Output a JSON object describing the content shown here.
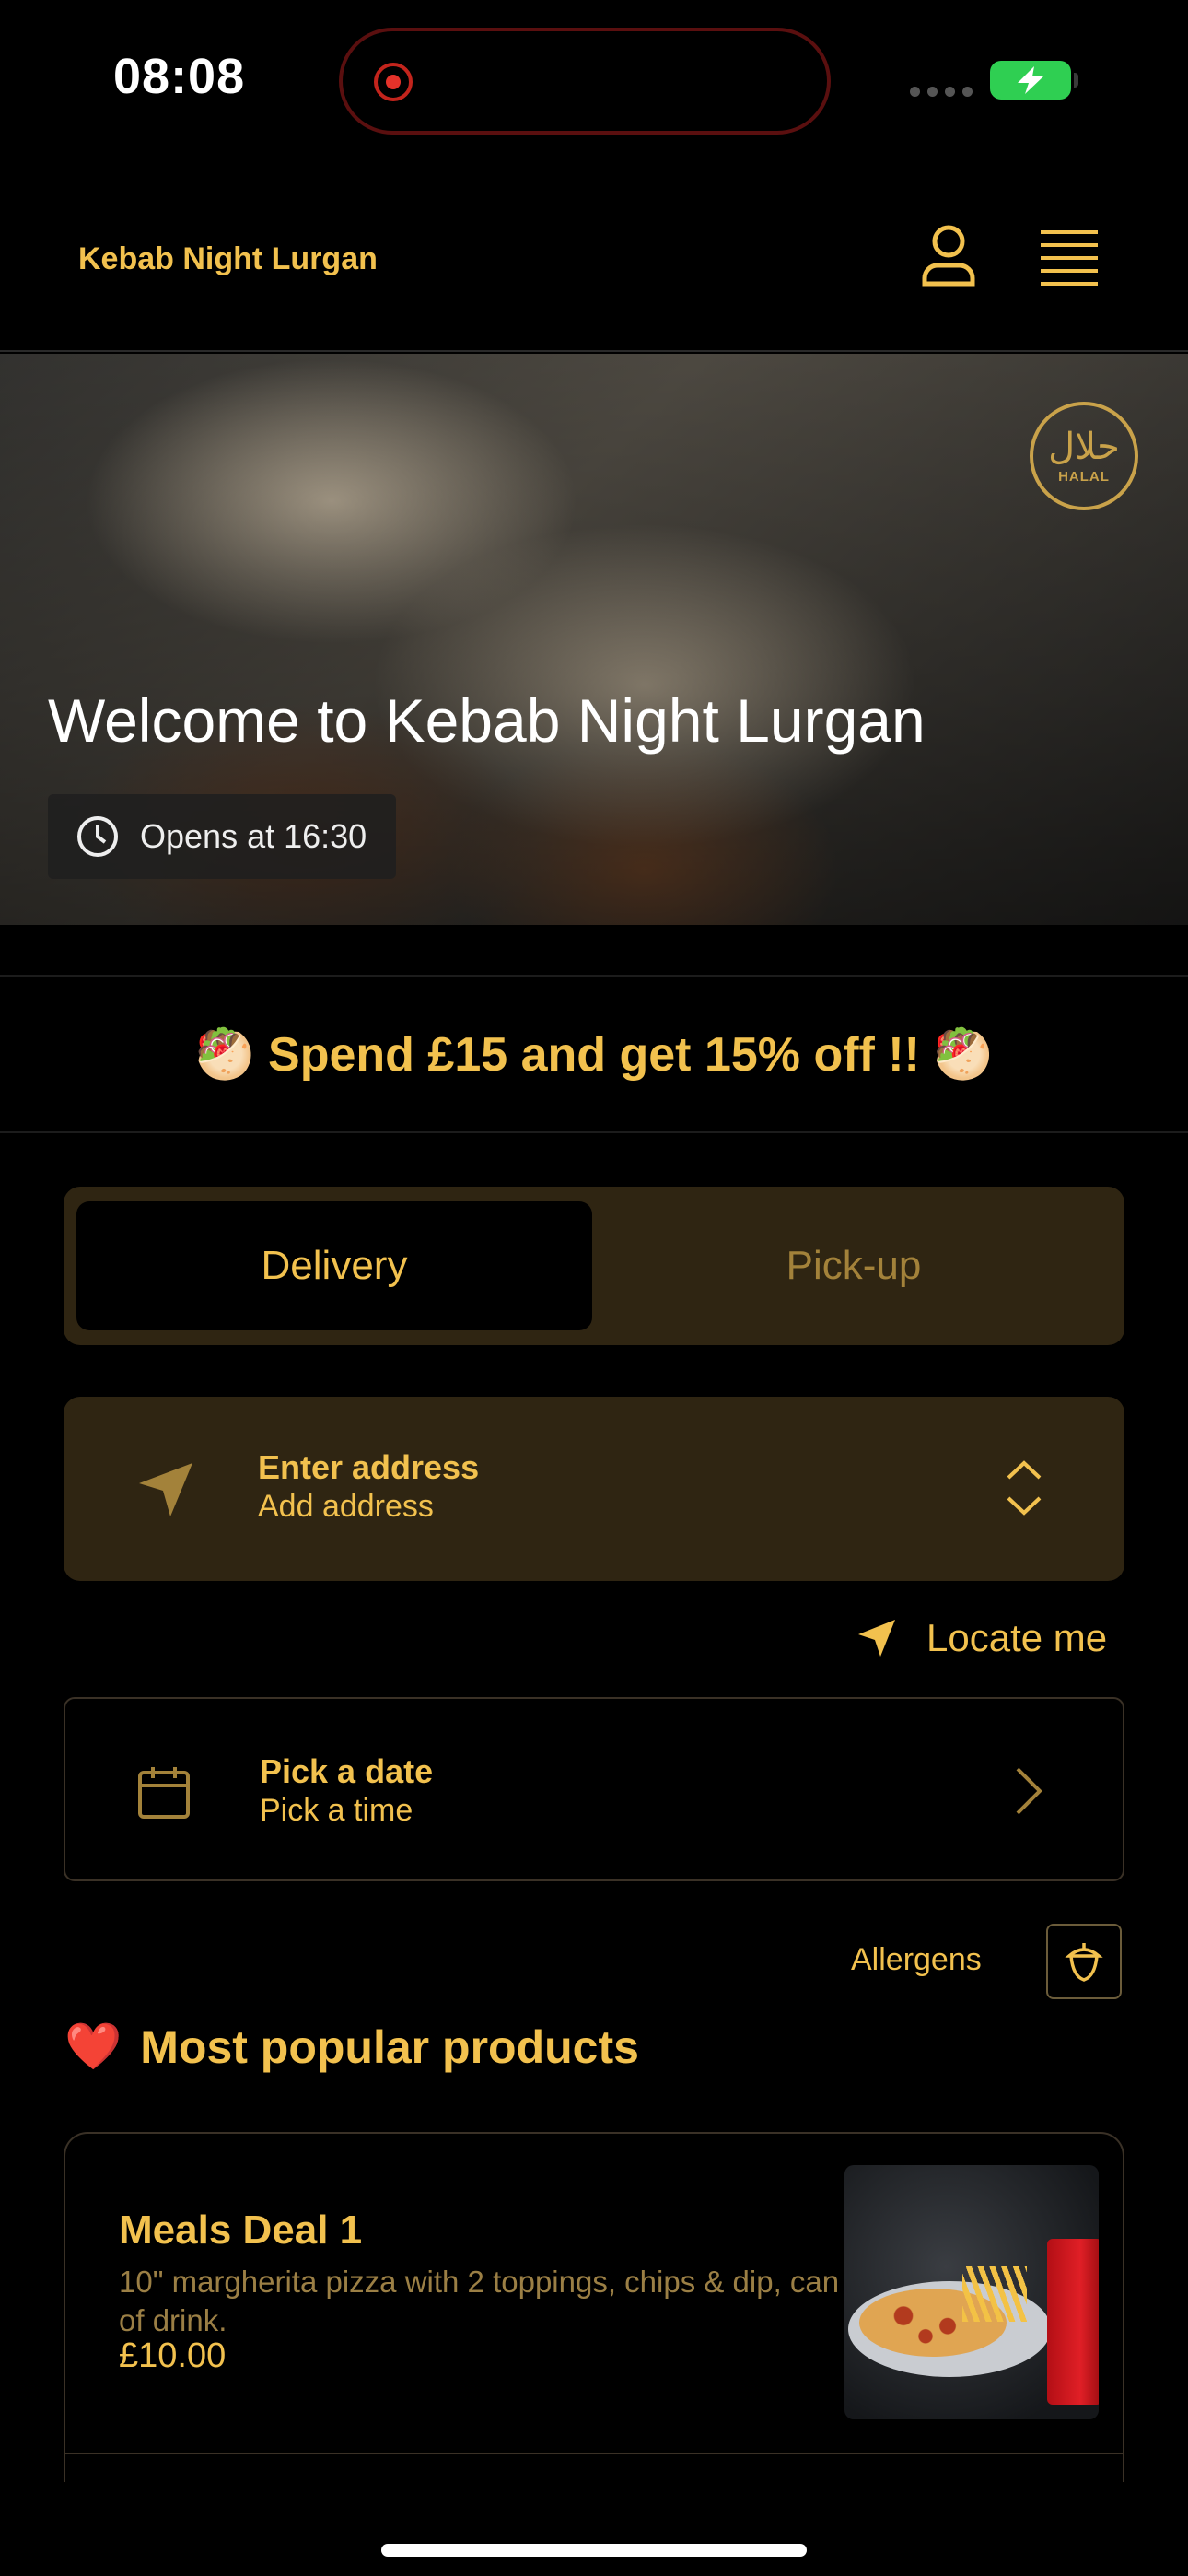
{
  "status_bar": {
    "time": "08:08"
  },
  "header": {
    "brand": "Kebab Night Lurgan",
    "account_icon": "user-icon",
    "menu_icon": "menu-icon"
  },
  "hero": {
    "welcome": "Welcome to Kebab Night Lurgan",
    "opens": "Opens at 16:30",
    "halal_badge_ar": "حلال",
    "halal_badge_en": "HALAL"
  },
  "promo": {
    "text": "🥙 Spend £15 and get 15% off !! 🥙"
  },
  "order_mode": {
    "tabs": [
      "Delivery",
      "Pick-up"
    ],
    "selected": "Delivery"
  },
  "address": {
    "title": "Enter address",
    "subtitle": "Add address"
  },
  "locate": {
    "label": "Locate me"
  },
  "schedule": {
    "title": "Pick a date",
    "subtitle": "Pick a time"
  },
  "allergens": {
    "label": "Allergens"
  },
  "popular": {
    "heading": "Most popular products",
    "heart": "❤️",
    "products": [
      {
        "name": "Meals Deal 1",
        "description": "10\" margherita pizza with 2 toppings, chips & dip, can of drink.",
        "price": "£10.00"
      }
    ]
  },
  "colors": {
    "accent": "#f2c14e",
    "panel": "#2f2512",
    "background": "#000000"
  }
}
